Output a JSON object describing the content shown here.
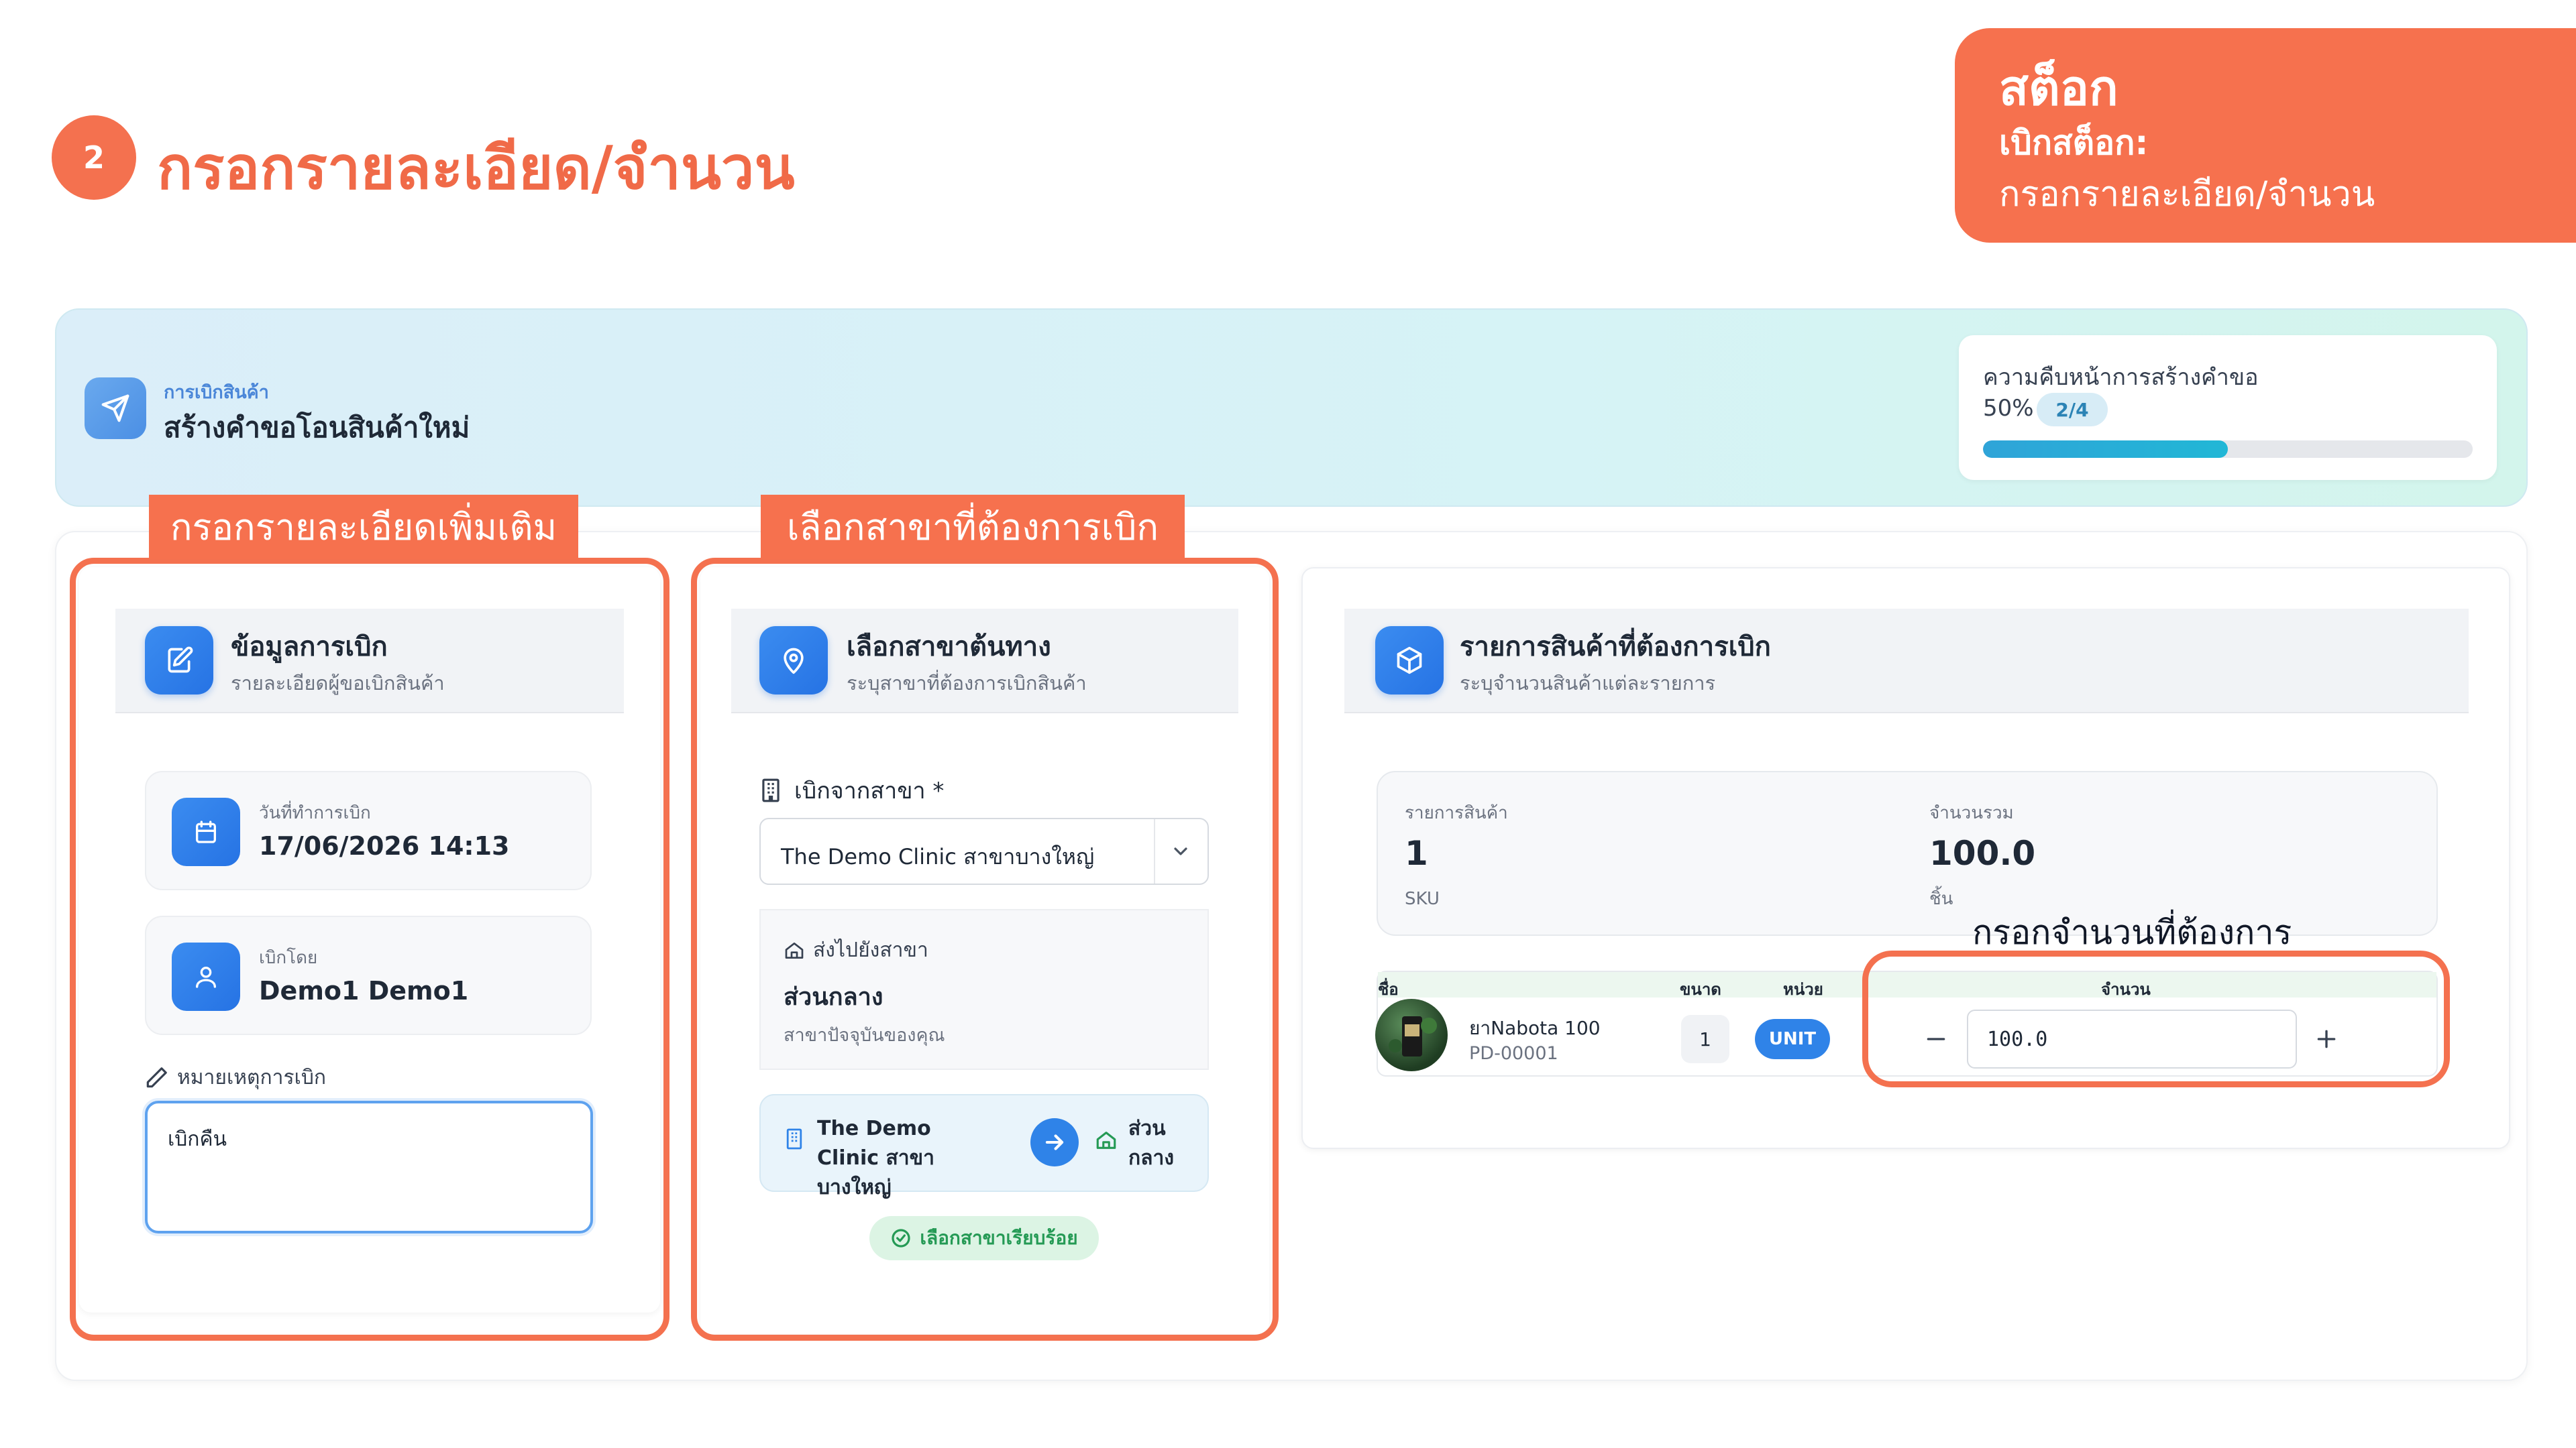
{
  "step": {
    "number": "2",
    "title": "กรอกรายละเอียด/จำนวน"
  },
  "tag": {
    "title": "สต็อก",
    "subtitle": "เบิกสต็อก:",
    "detail": "กรอกรายละเอียด/จำนวน"
  },
  "banner": {
    "section": "การเบิกสินค้า",
    "title": "สร้างคำขอโอนสินค้าใหม่",
    "progress_label": "ความคืบหน้าการสร้างคำขอ",
    "progress_percent_text": "50%",
    "progress_step": "2/4",
    "progress_value": 0.5
  },
  "annotations": {
    "details_label": "กรอกรายละเอียดเพิ่มเติม",
    "branch_label": "เลือกสาขาที่ต้องการเบิก",
    "quantity_callout": "กรอกจำนวนที่ต้องการ"
  },
  "withdraw_info": {
    "title": "ข้อมูลการเบิก",
    "subtitle": "รายละเอียดผู้ขอเบิกสินค้า",
    "date_label": "วันที่ทำการเบิก",
    "date_value": "17/06/2026 14:13",
    "by_label": "เบิกโดย",
    "by_value": "Demo1 Demo1",
    "note_label": "หมายเหตุการเบิก",
    "note_value": "เบิกคืน"
  },
  "branch": {
    "title": "เลือกสาขาต้นทาง",
    "subtitle": "ระบุสาขาที่ต้องการเบิกสินค้า",
    "from_label": "เบิกจากสาขา *",
    "from_value": "The Demo Clinic สาขาบางใหญ่",
    "dest_label": "ส่งไปยังสาขา",
    "dest_value": "ส่วนกลาง",
    "dest_note": "สาขาปัจจุบันของคุณ",
    "route_from": "The Demo Clinic สาขาบางใหญ่",
    "route_to": "ส่วน กลาง",
    "done_label": "เลือกสาขาเรียบร้อย"
  },
  "products": {
    "title": "รายการสินค้าที่ต้องการเบิก",
    "subtitle": "ระบุจำนวนสินค้าแต่ละรายการ",
    "summary": {
      "items_label": "รายการสินค้า",
      "items_value": "1",
      "items_unit": "SKU",
      "total_label": "จำนวนรวม",
      "total_value": "100.0",
      "total_unit": "ชิ้น"
    },
    "columns": {
      "name": "ชื่อ",
      "size": "ขนาด",
      "unit": "หน่วย",
      "qty": "จำนวน"
    },
    "rows": [
      {
        "name": "ยาNabota 100",
        "code": "PD-00001",
        "size": "1",
        "unit": "UNIT",
        "qty": "100.0"
      }
    ]
  },
  "colors": {
    "accent": "#f4714f",
    "primary": "#2f83e8",
    "success": "#259a55"
  }
}
